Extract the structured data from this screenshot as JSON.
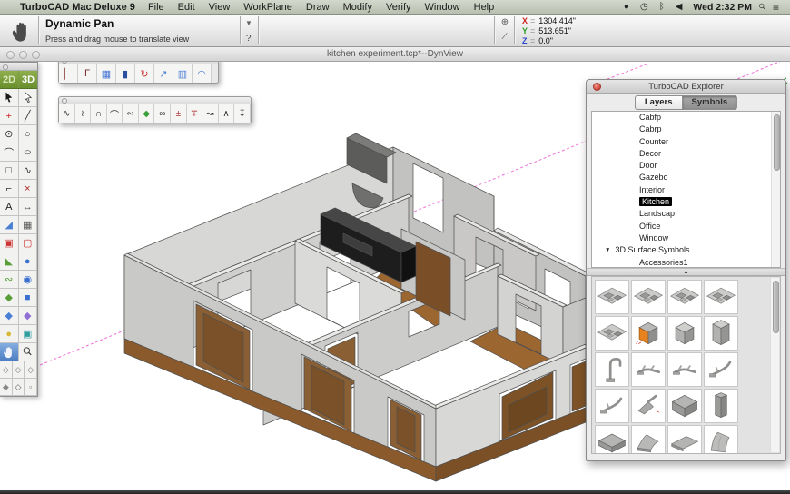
{
  "menubar": {
    "apple": "",
    "app_name": "TurboCAD Mac Deluxe 9",
    "menus": [
      "File",
      "Edit",
      "View",
      "WorkPlane",
      "Draw",
      "Modify",
      "Verify",
      "Window",
      "Help"
    ],
    "status_icons": [
      {
        "glyph": "●",
        "name": "menu-extra-icon"
      },
      {
        "glyph": "◷",
        "name": "clock-icon"
      },
      {
        "glyph": "ᛒ",
        "name": "bluetooth-icon"
      },
      {
        "glyph": "◀",
        "name": "volume-icon"
      }
    ],
    "time": "Wed 2:32 PM",
    "list_glyph": "≡"
  },
  "toolbar": {
    "tool_title": "Dynamic Pan",
    "tool_hint": "Press and drag mouse to translate view",
    "dropdown_glyph": "▼",
    "help_glyph": "?",
    "snap_glyph": "⊕",
    "angle_glyph": "∕",
    "coords": {
      "x_label": "X",
      "x_value": "1304.414\"",
      "y_label": "Y",
      "y_value": "513.651\"",
      "z_label": "Z",
      "z_value": "0.0\""
    }
  },
  "document": {
    "title": "kitchen experiment.tcp*--DynView"
  },
  "palette": {
    "tab_2d": "2D",
    "tab_3d": "3D",
    "tools": [
      {
        "glyph": "+",
        "c": "#cc2222",
        "name": "tool-point"
      },
      {
        "glyph": "╱",
        "c": "#333333",
        "name": "tool-line"
      },
      {
        "glyph": "⊙",
        "c": "#333333",
        "name": "tool-circle-center"
      },
      {
        "glyph": "○",
        "c": "#333333",
        "name": "tool-circle"
      },
      {
        "glyph": "⌒",
        "c": "#333333",
        "name": "tool-arc"
      },
      {
        "glyph": "○",
        "c": "#333333",
        "name": "tool-ellipse",
        "mod": "wide"
      },
      {
        "glyph": "□",
        "c": "#333333",
        "name": "tool-rectangle"
      },
      {
        "glyph": "∿",
        "c": "#333333",
        "name": "tool-spline"
      },
      {
        "glyph": "⌐",
        "c": "#333333",
        "name": "tool-polyline"
      },
      {
        "glyph": "×",
        "c": "#aa2222",
        "name": "tool-cross-trim"
      },
      {
        "glyph": "A",
        "c": "#222222",
        "name": "tool-text"
      },
      {
        "glyph": "↔",
        "c": "#444444",
        "name": "tool-dimension"
      },
      {
        "glyph": "◢",
        "c": "#4a7fd4",
        "name": "tool-roof"
      },
      {
        "glyph": "▦",
        "c": "#555555",
        "name": "tool-hatch"
      },
      {
        "glyph": "▣",
        "c": "#cc3333",
        "name": "tool-group"
      },
      {
        "glyph": "▢",
        "c": "#cc3333",
        "name": "tool-ungroup"
      },
      {
        "glyph": "◣",
        "c": "#5a9e3a",
        "name": "tool-cone"
      },
      {
        "glyph": "●",
        "c": "#3a6fd0",
        "name": "tool-sphere"
      },
      {
        "glyph": "∾",
        "c": "#5a9e3a",
        "name": "tool-twist"
      },
      {
        "glyph": "◉",
        "c": "#3a6fd0",
        "name": "tool-revolve"
      },
      {
        "glyph": "◆",
        "c": "#5a9e3a",
        "name": "tool-sweep"
      },
      {
        "glyph": "■",
        "c": "#3a6fd0",
        "name": "tool-box"
      },
      {
        "glyph": "◆",
        "c": "#4a7fd4",
        "name": "tool-prism"
      },
      {
        "glyph": "◆",
        "c": "#8f6fd4",
        "name": "tool-boolean"
      },
      {
        "glyph": "●",
        "c": "#d9b93a",
        "name": "tool-primitive-ball"
      },
      {
        "glyph": "▣",
        "c": "#2f9e9e",
        "name": "tool-material-panel"
      }
    ],
    "view_tools": [
      {
        "glyph": "◇",
        "c": "#777777",
        "name": "view-iso-1"
      },
      {
        "glyph": "◇",
        "c": "#777777",
        "name": "view-iso-2"
      },
      {
        "glyph": "◇",
        "c": "#777777",
        "name": "view-iso-3"
      },
      {
        "glyph": "◆",
        "c": "#888888",
        "name": "view-shaded"
      },
      {
        "glyph": "◇",
        "c": "#555555",
        "name": "view-wireframe"
      },
      {
        "glyph": "▫",
        "c": "#777777",
        "name": "view-grid"
      }
    ]
  },
  "arch_toolbar": {
    "tools": [
      {
        "glyph": "▏",
        "c": "#7a2a2a",
        "name": "arch-wall"
      },
      {
        "glyph": "Γ",
        "c": "#7a2a2a",
        "name": "arch-corner-wall"
      },
      {
        "glyph": "▦",
        "c": "#3a6fd0",
        "name": "arch-window"
      },
      {
        "glyph": "▮",
        "c": "#2a4fa0",
        "name": "arch-door"
      },
      {
        "glyph": "↻",
        "c": "#cc3333",
        "name": "arch-convert"
      },
      {
        "glyph": "↗",
        "c": "#4a7fd4",
        "name": "arch-roof-slab"
      },
      {
        "glyph": "▥",
        "c": "#4a7fd4",
        "name": "arch-wall-pattern"
      },
      {
        "glyph": "◠",
        "c": "#4a7fd4",
        "name": "arch-roof"
      }
    ]
  },
  "curve_toolbar": {
    "tools": [
      {
        "glyph": "∿",
        "c": "#333333",
        "name": "curve-spline"
      },
      {
        "glyph": "≀",
        "c": "#333333",
        "name": "curve-bezier"
      },
      {
        "glyph": "∩",
        "c": "#333333",
        "name": "curve-arc-3pt"
      },
      {
        "glyph": "⌒",
        "c": "#333333",
        "name": "curve-arc"
      },
      {
        "glyph": "∾",
        "c": "#333333",
        "name": "curve-sketch"
      },
      {
        "glyph": "◆",
        "c": "#3aa03a",
        "name": "curve-surface"
      },
      {
        "glyph": "∞",
        "c": "#333333",
        "name": "curve-coil"
      },
      {
        "glyph": "±",
        "c": "#aa3333",
        "name": "curve-add-node"
      },
      {
        "glyph": "∓",
        "c": "#aa3333",
        "name": "curve-remove-node"
      },
      {
        "glyph": "↝",
        "c": "#333333",
        "name": "curve-edit"
      },
      {
        "glyph": "∧",
        "c": "#333333",
        "name": "curve-corner"
      },
      {
        "glyph": "↧",
        "c": "#333333",
        "name": "curve-project"
      }
    ]
  },
  "explorer": {
    "title": "TurboCAD Explorer",
    "tabs": {
      "layers": "Layers",
      "symbols": "Symbols",
      "active": "Symbols"
    },
    "list": [
      {
        "label": "Cabfp"
      },
      {
        "label": "Cabrp"
      },
      {
        "label": "Counter"
      },
      {
        "label": "Decor"
      },
      {
        "label": "Door"
      },
      {
        "label": "Gazebo"
      },
      {
        "label": "Interior"
      },
      {
        "label": "Kitchen",
        "state": "selected"
      },
      {
        "label": "Landscap"
      },
      {
        "label": "Office"
      },
      {
        "label": "Window"
      },
      {
        "label": "3D Surface Symbols",
        "kind": "group"
      },
      {
        "label": "Accessories1"
      }
    ],
    "grid": [
      {
        "icon": "#sym-layout",
        "name": "thumb-kitchen-layout-1"
      },
      {
        "icon": "#sym-layout",
        "name": "thumb-kitchen-layout-2"
      },
      {
        "icon": "#sym-layout",
        "name": "thumb-kitchen-layout-3"
      },
      {
        "icon": "#sym-layout",
        "name": "thumb-kitchen-layout-4"
      },
      {
        "icon": "#sym-layout",
        "name": "thumb-kitchen-layout-5"
      },
      {
        "icon": "#sym-cab-orange",
        "name": "thumb-cabinet-selected",
        "variant": "selected"
      },
      {
        "icon": "#sym-cab",
        "name": "thumb-cabinet"
      },
      {
        "icon": "#sym-cab-tall",
        "name": "thumb-cabinet-tall"
      },
      {
        "icon": "#sym-faucet-tall",
        "name": "thumb-faucet-tall"
      },
      {
        "icon": "#sym-faucet-h",
        "name": "thumb-faucet-1"
      },
      {
        "icon": "#sym-faucet-h",
        "name": "thumb-faucet-2"
      },
      {
        "icon": "#sym-faucet-angle",
        "name": "thumb-faucet-3"
      },
      {
        "icon": "#sym-faucet-angle",
        "name": "thumb-faucet-4"
      },
      {
        "icon": "#sym-sprayer",
        "name": "thumb-sprayer"
      },
      {
        "icon": "#sym-box-large",
        "name": "thumb-appliance-large"
      },
      {
        "icon": "#sym-box-tall",
        "name": "thumb-appliance-tall"
      },
      {
        "icon": "#sym-box-wide",
        "name": "thumb-appliance-wide"
      },
      {
        "icon": "#sym-hood-wedge",
        "name": "thumb-hood-wedge"
      },
      {
        "icon": "#sym-hood-flat",
        "name": "thumb-hood-flat"
      },
      {
        "icon": "#sym-hood-curve",
        "name": "thumb-hood-curved"
      }
    ]
  },
  "colors": {
    "menubar": "#c3c9bc",
    "palette_green": "#6d9430",
    "selection_black": "#000000",
    "symbol_orange": "#e8821e",
    "floor_brown": "#9c6631",
    "base_brown": "#8a5a2c",
    "wall_gray": "#c9c9c7",
    "construction_pink": "#ee6fd5",
    "snap_green": "#3aa03a",
    "coord_x": "#cc2222",
    "coord_y": "#2a9a2a",
    "coord_z": "#2a49cc",
    "active_tool_blue": "#4c7ec2"
  }
}
